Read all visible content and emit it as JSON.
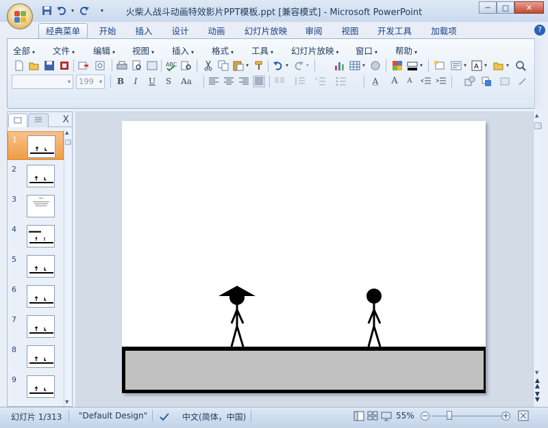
{
  "window": {
    "title": "火柴人战斗动画特效影片PPT模板.ppt [兼容模式] - Microsoft PowerPoint",
    "minimize_glyph": "─",
    "maximize_glyph": "□",
    "close_glyph": "✕"
  },
  "ribbon_tabs": [
    {
      "label": "经典菜单"
    },
    {
      "label": "开始"
    },
    {
      "label": "插入"
    },
    {
      "label": "设计"
    },
    {
      "label": "动画"
    },
    {
      "label": "幻灯片放映"
    },
    {
      "label": "审阅"
    },
    {
      "label": "视图"
    },
    {
      "label": "开发工具"
    },
    {
      "label": "加载项"
    }
  ],
  "help_glyph": "?",
  "classic_menu": [
    {
      "label": "全部"
    },
    {
      "label": "文件"
    },
    {
      "label": "编辑"
    },
    {
      "label": "视图"
    },
    {
      "label": "插入"
    },
    {
      "label": "格式"
    },
    {
      "label": "工具"
    },
    {
      "label": "幻灯片放映"
    },
    {
      "label": "窗口"
    },
    {
      "label": "帮助"
    }
  ],
  "menu_arrow": "▾",
  "format_bar": {
    "font_name": "",
    "font_size": "199",
    "bold": "B",
    "italic": "I",
    "underline": "U",
    "shadow": "S",
    "change_case": "Aa",
    "font_color": "A",
    "grow_font": "A",
    "shrink_font": "A"
  },
  "slide_pane": {
    "close_glyph": "X",
    "slide_numbers": [
      "1",
      "2",
      "3",
      "4",
      "5",
      "6",
      "7",
      "8",
      "9"
    ],
    "selected_slide": "1"
  },
  "status": {
    "slide_position": "幻灯片 1/313",
    "theme": "\"Default Design\"",
    "language": "中文(简体，中国)",
    "zoom": "55%",
    "zoom_out": "−",
    "zoom_in": "+"
  },
  "colors": {
    "ribbon_blue": "#1e395b",
    "selected_thumb": "#f09c45",
    "ground_fill": "#c0c0c0",
    "stroke": "#000000"
  }
}
